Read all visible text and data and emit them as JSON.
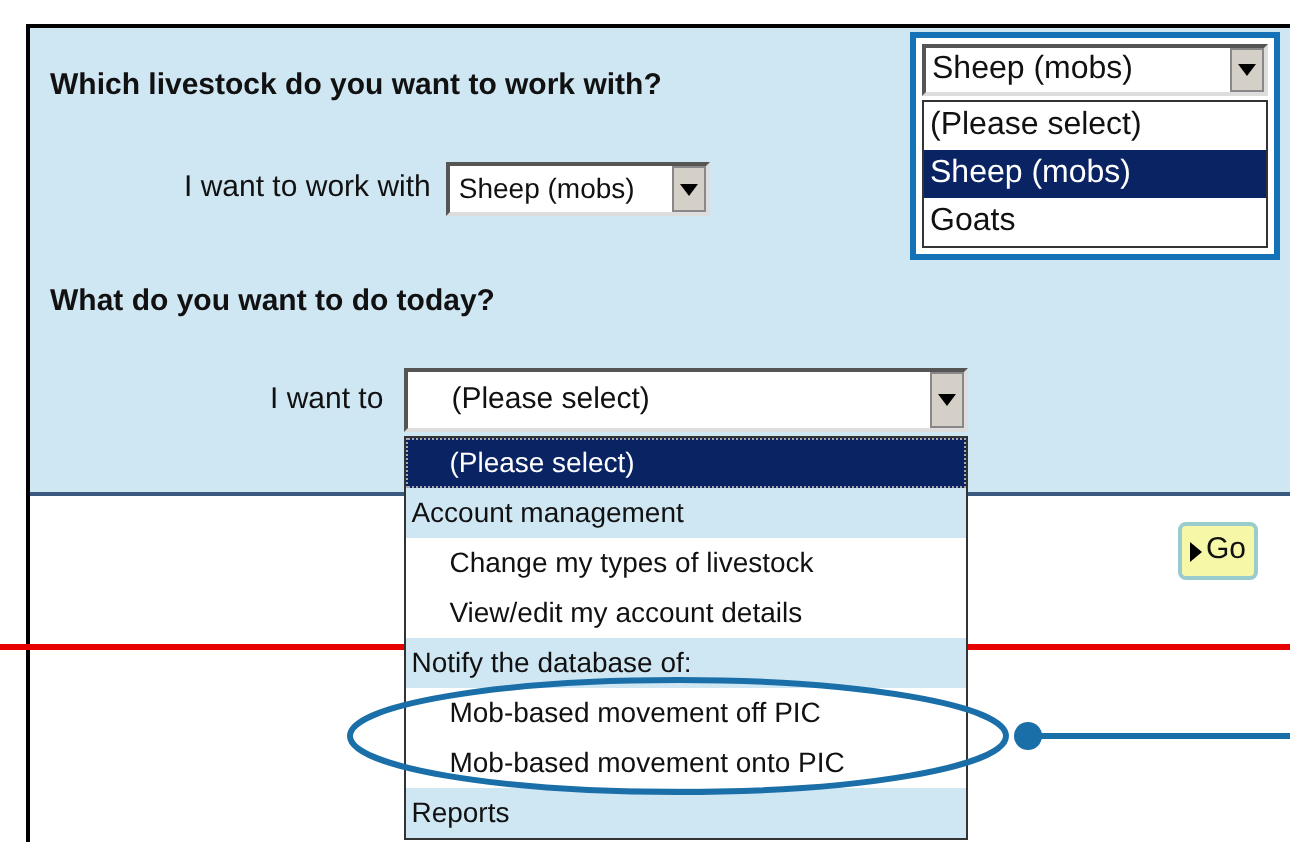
{
  "livestock": {
    "heading": "Which livestock do you want to work with?",
    "label": "I want to work with",
    "value": "Sheep (mobs)"
  },
  "callout": {
    "value": "Sheep (mobs)",
    "options": [
      {
        "label": "(Please select)",
        "selected": false
      },
      {
        "label": "Sheep (mobs)",
        "selected": true
      },
      {
        "label": "Goats",
        "selected": false
      }
    ]
  },
  "task": {
    "heading": "What do you want to do today?",
    "label": "I want to",
    "value": "(Please select)",
    "options": [
      {
        "kind": "option",
        "label": "(Please select)",
        "selected": true
      },
      {
        "kind": "group",
        "label": "Account management",
        "children": [
          {
            "label": "Change my types of livestock",
            "selected": false
          },
          {
            "label": "View/edit my account details",
            "selected": false
          }
        ]
      },
      {
        "kind": "group",
        "label": "Notify the database of:",
        "children": [
          {
            "label": "Mob-based movement off PIC",
            "selected": false
          },
          {
            "label": "Mob-based movement onto PIC",
            "selected": false
          }
        ]
      },
      {
        "kind": "group",
        "label": "Reports"
      }
    ]
  },
  "go_button": {
    "label": "Go"
  }
}
